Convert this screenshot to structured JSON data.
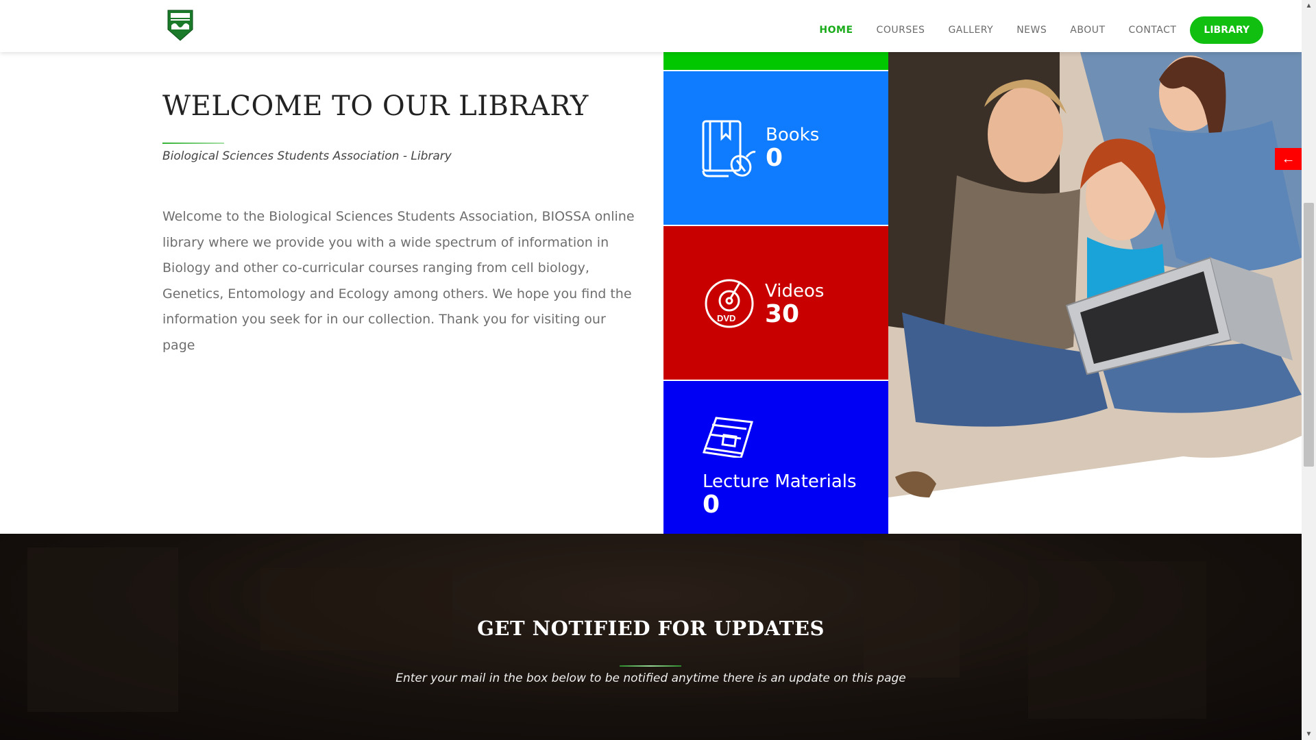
{
  "nav": {
    "items": [
      "HOME",
      "COURSES",
      "GALLERY",
      "NEWS",
      "ABOUT",
      "CONTACT"
    ],
    "active": "HOME",
    "library_button": "LIBRARY"
  },
  "welcome": {
    "title": "WELCOME TO OUR LIBRARY",
    "subtitle": "Biological Sciences Students Association - Library",
    "body": "Welcome to the Biological Sciences Students Association, BIOSSA online library where we provide you with a wide spectrum of information in Biology and other co-curricular courses ranging from cell biology, Genetics, Entomology and Ecology among others. We hope you find the information you seek for in our collection. Thank you for visiting our page"
  },
  "stats": {
    "books": {
      "label": "Books",
      "count": "0",
      "icon": "book-mouse-icon",
      "color": "#0f7cff"
    },
    "videos": {
      "label": "Videos",
      "count": "30",
      "icon": "dvd-icon",
      "color": "#c80000"
    },
    "lectures": {
      "label": "Lecture Materials",
      "count": "0",
      "icon": "magazine-icon",
      "color": "#0000f5"
    },
    "top_bar_color": "#00c700"
  },
  "slider": {
    "prev_arrow": "←"
  },
  "notify": {
    "title": "GET NOTIFIED FOR UPDATES",
    "text": "Enter your mail in the box below to be notified anytime there is an update on this page"
  },
  "colors": {
    "accent": "#10bf10",
    "active_nav": "#1aab1a",
    "arrow": "#ff0000"
  }
}
